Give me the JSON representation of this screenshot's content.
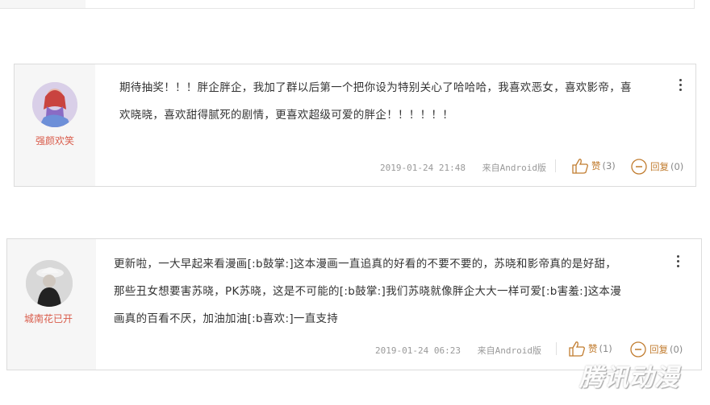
{
  "comments": [
    {
      "user": "强颜欢笑",
      "lines": [
        "期待抽奖！！！胖企胖企，我加了群以后第一个把你设为特别关心了哈哈哈，我喜欢恶女，喜欢影帝，喜",
        "欢晓晓，喜欢甜得腻死的剧情，更喜欢超级可爱的胖企！！！！！！"
      ],
      "time": "2019-01-24 21:48",
      "source": "来自Android版",
      "like_label": "赞",
      "like_count": "(3)",
      "reply_label": "回复",
      "reply_count": "(0)"
    },
    {
      "user": "城南花已开",
      "lines": [
        "更新啦，一大早起来看漫画[:b鼓掌:]这本漫画一直追真的好看的不要不要的，苏晓和影帝真的是好甜，",
        "那些丑女想要害苏晓，PK苏晓，这是不可能的[:b鼓掌:]我们苏晓就像胖企大大一样可爱[:b害羞:]这本漫",
        "画真的百看不厌，加油加油[:b喜欢:]一直支持"
      ],
      "time": "2019-01-24 06:23",
      "source": "来自Android版",
      "like_label": "赞",
      "like_count": "(1)",
      "reply_label": "回复",
      "reply_count": "(0)"
    }
  ],
  "watermark": "腾讯动漫",
  "colors": {
    "username": "#d95b4a",
    "action": "#c17c2f",
    "meta": "#999999",
    "border": "#dcdcdc"
  }
}
